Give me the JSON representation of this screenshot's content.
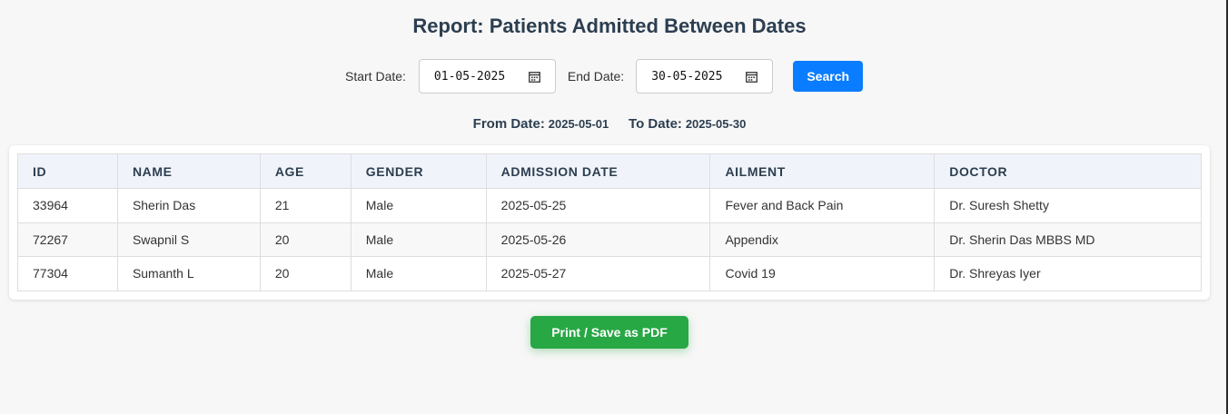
{
  "title": "Report: Patients Admitted Between Dates",
  "filters": {
    "start_label": "Start Date:",
    "start_value": "01-05-2025",
    "end_label": "End Date:",
    "end_value": "30-05-2025",
    "search_label": "Search",
    "calendar_icon": "calendar-icon"
  },
  "range": {
    "from_label": "From Date:",
    "from_value": "2025-05-01",
    "to_label": "To Date:",
    "to_value": "2025-05-30"
  },
  "table": {
    "headers": [
      "ID",
      "NAME",
      "AGE",
      "GENDER",
      "ADMISSION DATE",
      "AILMENT",
      "DOCTOR"
    ],
    "rows": [
      [
        "33964",
        "Sherin Das",
        "21",
        "Male",
        "2025-05-25",
        "Fever and Back Pain",
        "Dr. Suresh Shetty"
      ],
      [
        "72267",
        "Swapnil S",
        "20",
        "Male",
        "2025-05-26",
        "Appendix",
        "Dr. Sherin Das MBBS MD"
      ],
      [
        "77304",
        "Sumanth L",
        "20",
        "Male",
        "2025-05-27",
        "Covid 19",
        "Dr. Shreyas Iyer"
      ]
    ]
  },
  "print_label": "Print / Save as PDF",
  "colors": {
    "search_button": "#0a7cff",
    "print_button": "#28a745",
    "header_text": "#2c3e50",
    "table_header_bg": "#f0f4fa"
  }
}
